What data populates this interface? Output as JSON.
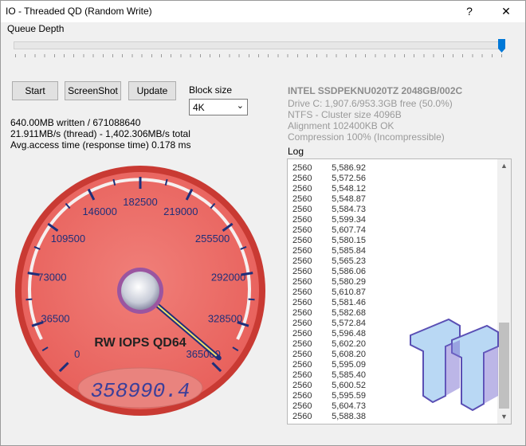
{
  "window": {
    "title": "IO - Threaded QD (Random Write)",
    "help_label": "?",
    "close_label": "✕"
  },
  "queue_depth": {
    "label": "Queue Depth",
    "value_fraction": 1.0
  },
  "buttons": {
    "start": "Start",
    "screenshot": "ScreenShot",
    "update": "Update"
  },
  "block_size": {
    "label": "Block size",
    "value": "4K"
  },
  "stats": {
    "line1": "640.00MB written / 671088640",
    "line2": "21.911MB/s (thread) - 1,402.306MB/s total",
    "line3": "Avg.access time (response time) 0.178 ms"
  },
  "drive": {
    "name": "INTEL SSDPEKNU020TZ 2048GB/002C",
    "info": [
      "Drive C: 1,907.6/953.3GB free (50.0%)",
      "NTFS - Cluster size 4096B",
      "Alignment 102400KB OK",
      "Compression 100% (Incompressible)"
    ]
  },
  "log": {
    "label": "Log",
    "rows": [
      [
        "2560",
        "5,586.92"
      ],
      [
        "2560",
        "5,572.56"
      ],
      [
        "2560",
        "5,548.12"
      ],
      [
        "2560",
        "5,548.87"
      ],
      [
        "2560",
        "5,584.73"
      ],
      [
        "2560",
        "5,599.34"
      ],
      [
        "2560",
        "5,607.74"
      ],
      [
        "2560",
        "5,580.15"
      ],
      [
        "2560",
        "5,585.84"
      ],
      [
        "2560",
        "5,565.23"
      ],
      [
        "2560",
        "5,586.06"
      ],
      [
        "2560",
        "5,580.29"
      ],
      [
        "2560",
        "5,610.87"
      ],
      [
        "2560",
        "5,581.46"
      ],
      [
        "2560",
        "5,582.68"
      ],
      [
        "2560",
        "5,572.84"
      ],
      [
        "2560",
        "5,596.48"
      ],
      [
        "2560",
        "5,602.20"
      ],
      [
        "2560",
        "5,608.20"
      ],
      [
        "2560",
        "5,595.09"
      ],
      [
        "2560",
        "5,585.40"
      ],
      [
        "2560",
        "5,600.52"
      ],
      [
        "2560",
        "5,595.59"
      ],
      [
        "2560",
        "5,604.73"
      ],
      [
        "2560",
        "5,588.38"
      ]
    ]
  },
  "gauge": {
    "ticks": [
      "0",
      "36500",
      "73000",
      "109500",
      "146000",
      "182500",
      "219000",
      "255500",
      "292000",
      "328500",
      "365000"
    ],
    "caption": "RW IOPS QD64",
    "readout": "358990.4",
    "value": 358990.4,
    "max": 365000
  },
  "colors": {
    "accent": "#0078d7",
    "gauge_face": "#e8615c",
    "gauge_ring": "#c93a33",
    "readout": "#3b3f9a"
  },
  "logo": {
    "icon": "tt-logo-icon"
  }
}
